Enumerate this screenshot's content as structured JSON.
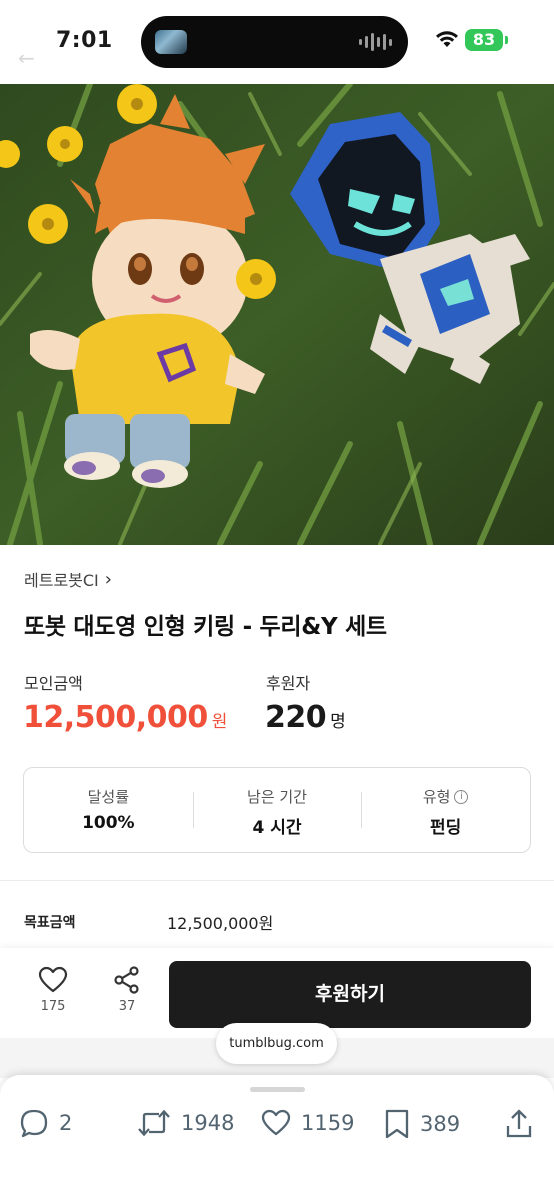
{
  "status_bar": {
    "time": "7:01",
    "battery": "83"
  },
  "product": {
    "creator": "레트로봇CI",
    "title": "또봇 대도영 인형 키링 - 두리&Y 세트",
    "amount_label": "모인금액",
    "amount_value": "12,500,000",
    "amount_unit": "원",
    "backers_label": "후원자",
    "backers_value": "220",
    "backers_unit": "명"
  },
  "info_box": [
    {
      "label": "달성률",
      "value": "100%"
    },
    {
      "label": "남은 기간",
      "value": "4 시간"
    },
    {
      "label": "유형",
      "value": "펀딩"
    }
  ],
  "goal": {
    "label": "목표금액",
    "value": "12,500,000원"
  },
  "actions": {
    "like_count": "175",
    "share_count": "37",
    "support_label": "후원하기"
  },
  "url_pill": "tumblbug.com",
  "tweet_bar": {
    "replies": "2",
    "retweets": "1948",
    "likes": "1159",
    "bookmarks": "389"
  },
  "colors": {
    "accent_red": "#f0503a",
    "button_dark": "#1c1c1c",
    "battery_green": "#33c759"
  }
}
